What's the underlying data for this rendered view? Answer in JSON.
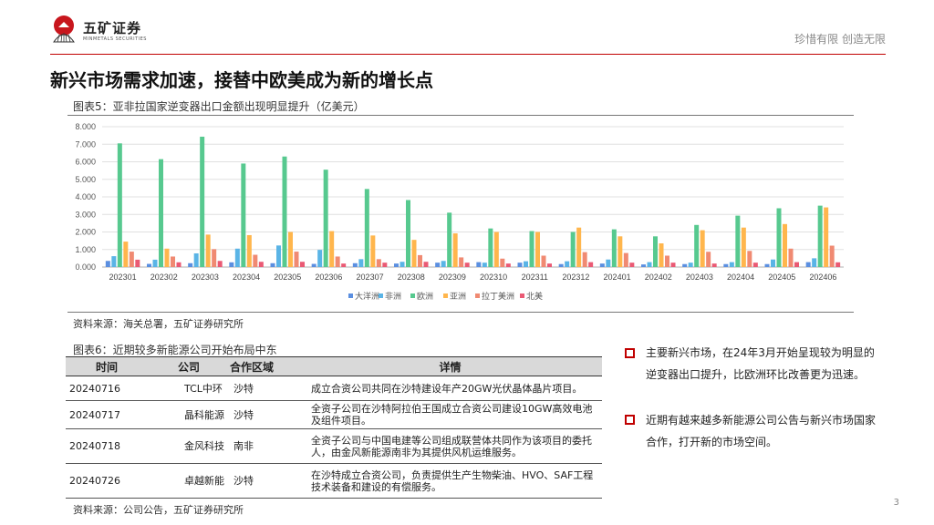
{
  "header": {
    "brand_cn": "五矿证券",
    "brand_en": "MINMETALS SECURITIES",
    "slogan": "珍惜有限  创造无限"
  },
  "page": {
    "title": "新兴市场需求加速，接替中欧美成为新的增长点",
    "page_number": "3"
  },
  "colors": {
    "accent": "#c00000",
    "oceania": "#5b8fe0",
    "africa": "#5ab4e6",
    "europe": "#57c98f",
    "asia": "#ffb64d",
    "latam": "#f08a72",
    "na": "#ea5a74"
  },
  "chart_caption": "图表5：亚非拉国家逆变器出口金额出现明显提升（亿美元）",
  "chart_source": "资料来源：海关总署，五矿证券研究所",
  "chart_data": {
    "type": "bar",
    "title": "图表5：亚非拉国家逆变器出口金额出现明显提升（亿美元）",
    "xlabel": "",
    "ylabel": "",
    "ylim": [
      0,
      8
    ],
    "yticks": [
      "0.000",
      "1.000",
      "2.000",
      "3.000",
      "4.000",
      "5.000",
      "6.000",
      "7.000",
      "8.000"
    ],
    "grid": true,
    "legend": "bottom",
    "categories": [
      "202301",
      "202302",
      "202303",
      "202304",
      "202305",
      "202306",
      "202307",
      "202308",
      "202309",
      "202310",
      "202311",
      "202312",
      "202401",
      "202402",
      "202403",
      "202404",
      "202405",
      "202406"
    ],
    "series": [
      {
        "name": "大洋洲",
        "color": "#5b8fe0",
        "values": [
          0.35,
          0.18,
          0.22,
          0.27,
          0.22,
          0.18,
          0.22,
          0.2,
          0.25,
          0.28,
          0.25,
          0.17,
          0.2,
          0.15,
          0.17,
          0.17,
          0.17,
          0.28
        ]
      },
      {
        "name": "非洲",
        "color": "#5ab4e6",
        "values": [
          0.62,
          0.42,
          0.78,
          1.05,
          1.23,
          0.98,
          0.45,
          0.3,
          0.35,
          0.25,
          0.33,
          0.33,
          0.43,
          0.28,
          0.25,
          0.28,
          0.43,
          0.5
        ]
      },
      {
        "name": "欧洲",
        "color": "#57c98f",
        "values": [
          7.05,
          6.15,
          7.43,
          5.9,
          6.3,
          5.55,
          4.45,
          3.82,
          3.1,
          2.2,
          2.05,
          2.0,
          2.15,
          1.75,
          2.4,
          2.93,
          3.35,
          3.5
        ]
      },
      {
        "name": "亚洲",
        "color": "#ffb64d",
        "values": [
          1.45,
          1.05,
          1.85,
          1.82,
          2.0,
          2.05,
          1.8,
          1.55,
          1.92,
          2.0,
          2.0,
          2.25,
          1.75,
          1.35,
          2.1,
          2.25,
          2.45,
          3.4
        ]
      },
      {
        "name": "拉丁美洲",
        "color": "#f08a72",
        "values": [
          0.88,
          0.6,
          1.02,
          0.7,
          0.88,
          0.6,
          0.45,
          0.68,
          0.55,
          0.48,
          0.65,
          0.85,
          0.8,
          0.65,
          0.87,
          0.92,
          1.05,
          1.22
        ]
      },
      {
        "name": "北美",
        "color": "#ea5a74",
        "values": [
          0.42,
          0.27,
          0.35,
          0.3,
          0.3,
          0.2,
          0.25,
          0.3,
          0.25,
          0.2,
          0.2,
          0.28,
          0.25,
          0.25,
          0.2,
          0.25,
          0.28,
          0.27
        ]
      }
    ]
  },
  "table": {
    "caption": "图表6：近期较多新能源公司开始布局中东",
    "headers": [
      "时间",
      "公司",
      "合作区域",
      "详情"
    ],
    "rows": [
      [
        "20240716",
        "TCL中环",
        "沙特",
        "成立合资公司共同在沙特建设年产20GW光伏晶体晶片项目。"
      ],
      [
        "20240717",
        "晶科能源",
        "沙特",
        "全资子公司在沙特阿拉伯王国成立合资公司建设10GW高效电池及组件项目。"
      ],
      [
        "20240718",
        "金风科技",
        "南非",
        "全资子公司与中国电建等公司组成联营体共同作为该项目的委托人，由金风新能源南非为其提供风机运维服务。"
      ],
      [
        "20240726",
        "卓越新能",
        "沙特",
        "在沙特成立合资公司，负责提供生产生物柴油、HVO、SAF工程技术装备和建设的有偿服务。"
      ]
    ],
    "source": "资料来源：公司公告，五矿证券研究所"
  },
  "bullets": [
    "主要新兴市场，在24年3月开始呈现较为明显的逆变器出口提升，比欧洲环比改善更为迅速。",
    "近期有越来越多新能源公司公告与新兴市场国家合作，打开新的市场空间。"
  ]
}
